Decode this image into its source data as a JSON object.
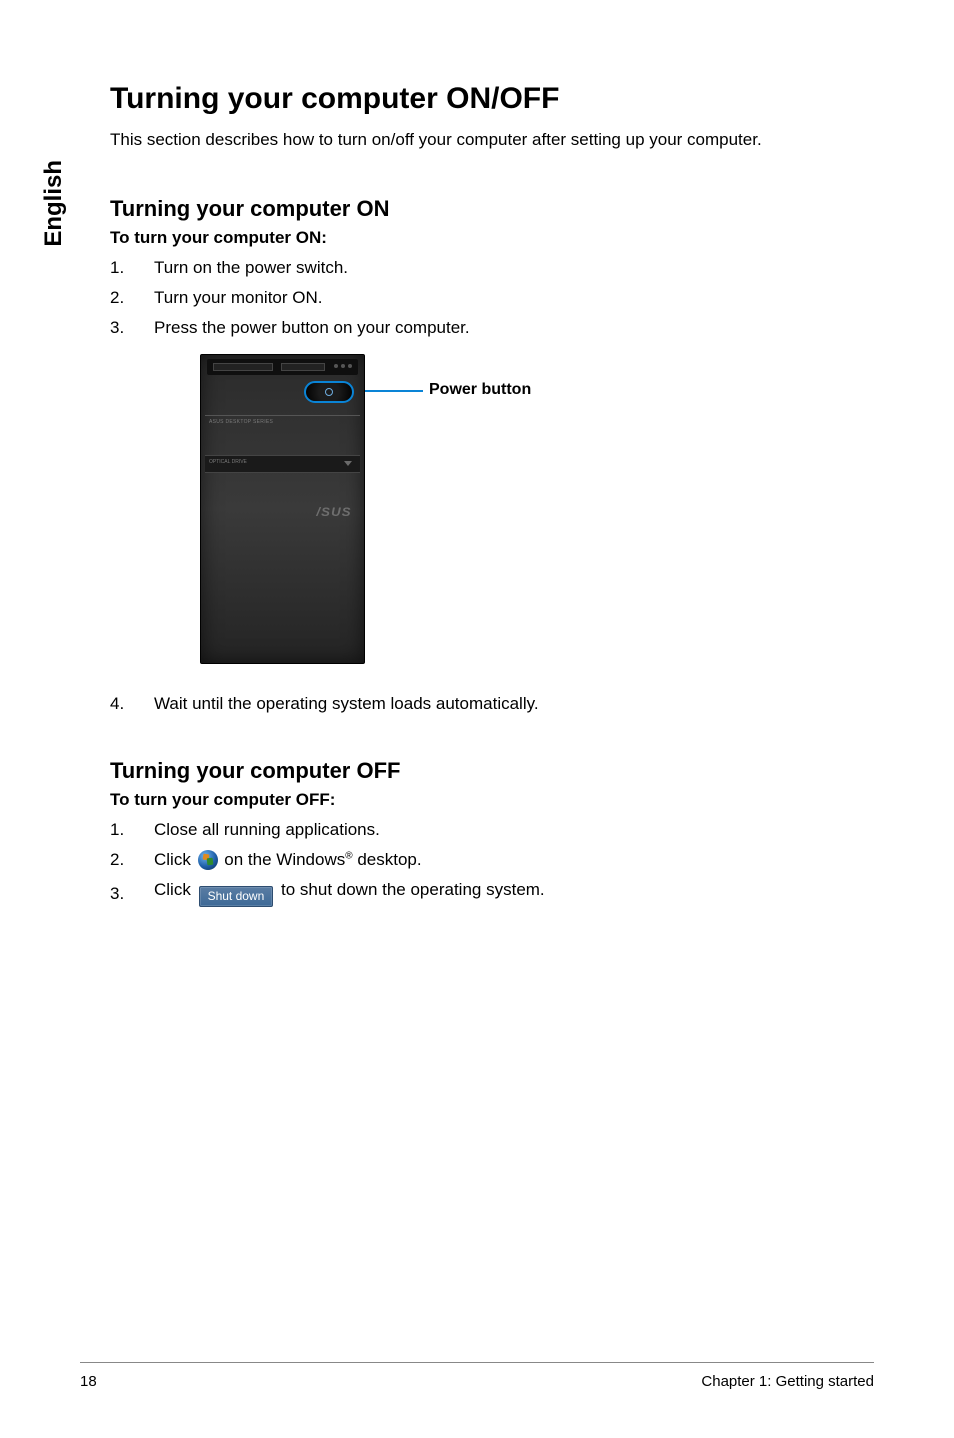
{
  "side_tab": "English",
  "title": "Turning your computer ON/OFF",
  "intro": "This section describes how to turn on/off your computer after setting up your computer.",
  "on": {
    "heading": "Turning your computer ON",
    "bold": "To turn your computer ON:",
    "steps": [
      "Turn on the power switch.",
      "Turn your monitor ON.",
      "Press the power button on your computer."
    ],
    "after_fig_step_num": "4.",
    "after_fig_step": "Wait until the operating system loads automatically."
  },
  "figure": {
    "callout": "Power button",
    "logo": "/SUS",
    "label1": "ASUS DESKTOP SERIES",
    "label2": "OPTICAL DRIVE"
  },
  "off": {
    "heading": "Turning your computer OFF",
    "bold": "To turn your computer OFF:",
    "step1": "Close all running applications.",
    "step2_pre": "Click ",
    "step2_post_a": " on the Windows",
    "step2_post_b": " desktop.",
    "step3_pre": "Click ",
    "step3_btn": "Shut down",
    "step3_post": " to shut down the operating system.",
    "nums": [
      "1.",
      "2.",
      "3."
    ]
  },
  "nums_on": [
    "1.",
    "2.",
    "3."
  ],
  "footer": {
    "page": "18",
    "chapter": "Chapter 1: Getting started"
  },
  "reg_mark": "®"
}
